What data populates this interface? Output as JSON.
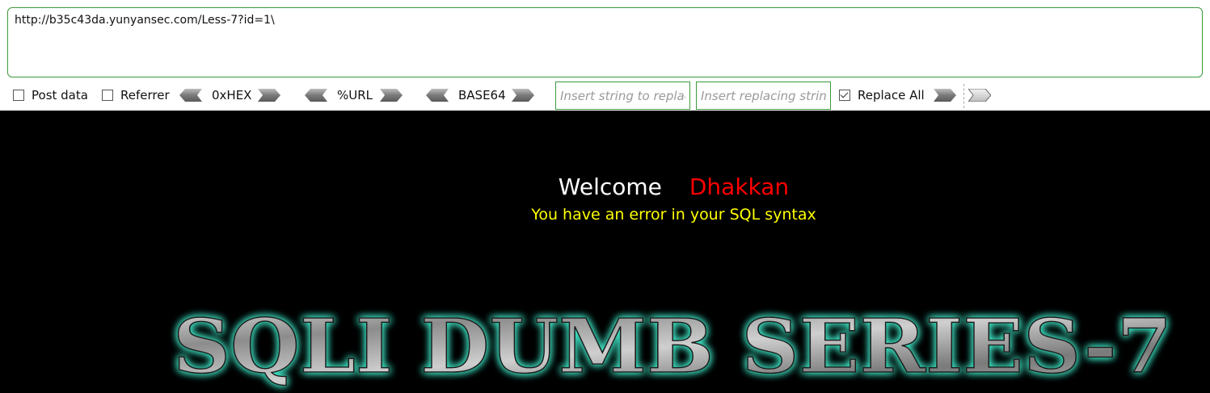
{
  "url_bar": {
    "value": "http://b35c43da.yunyansec.com/Less-7?id=1\\"
  },
  "toolbar": {
    "post_data": {
      "label": "Post data",
      "checked": false
    },
    "referrer": {
      "label": "Referrer",
      "checked": false
    },
    "hex_label": "0xHEX",
    "url_label": "%URL",
    "base64_label": "BASE64",
    "replace_find_placeholder": "Insert string to replace",
    "replace_with_placeholder": "Insert replacing string",
    "replace_all": {
      "label": "Replace All",
      "checked": true
    }
  },
  "page": {
    "welcome": "Welcome",
    "user": "Dhakkan",
    "error": "You have an error in your SQL syntax",
    "banner_text": "SQLI DUMB SERIES-7"
  },
  "colors": {
    "welcome": "#ffffff",
    "user": "#ff0000",
    "error": "#ffff00",
    "banner_glow": "#3fe6c6",
    "input_border": "#3c9a3c"
  }
}
